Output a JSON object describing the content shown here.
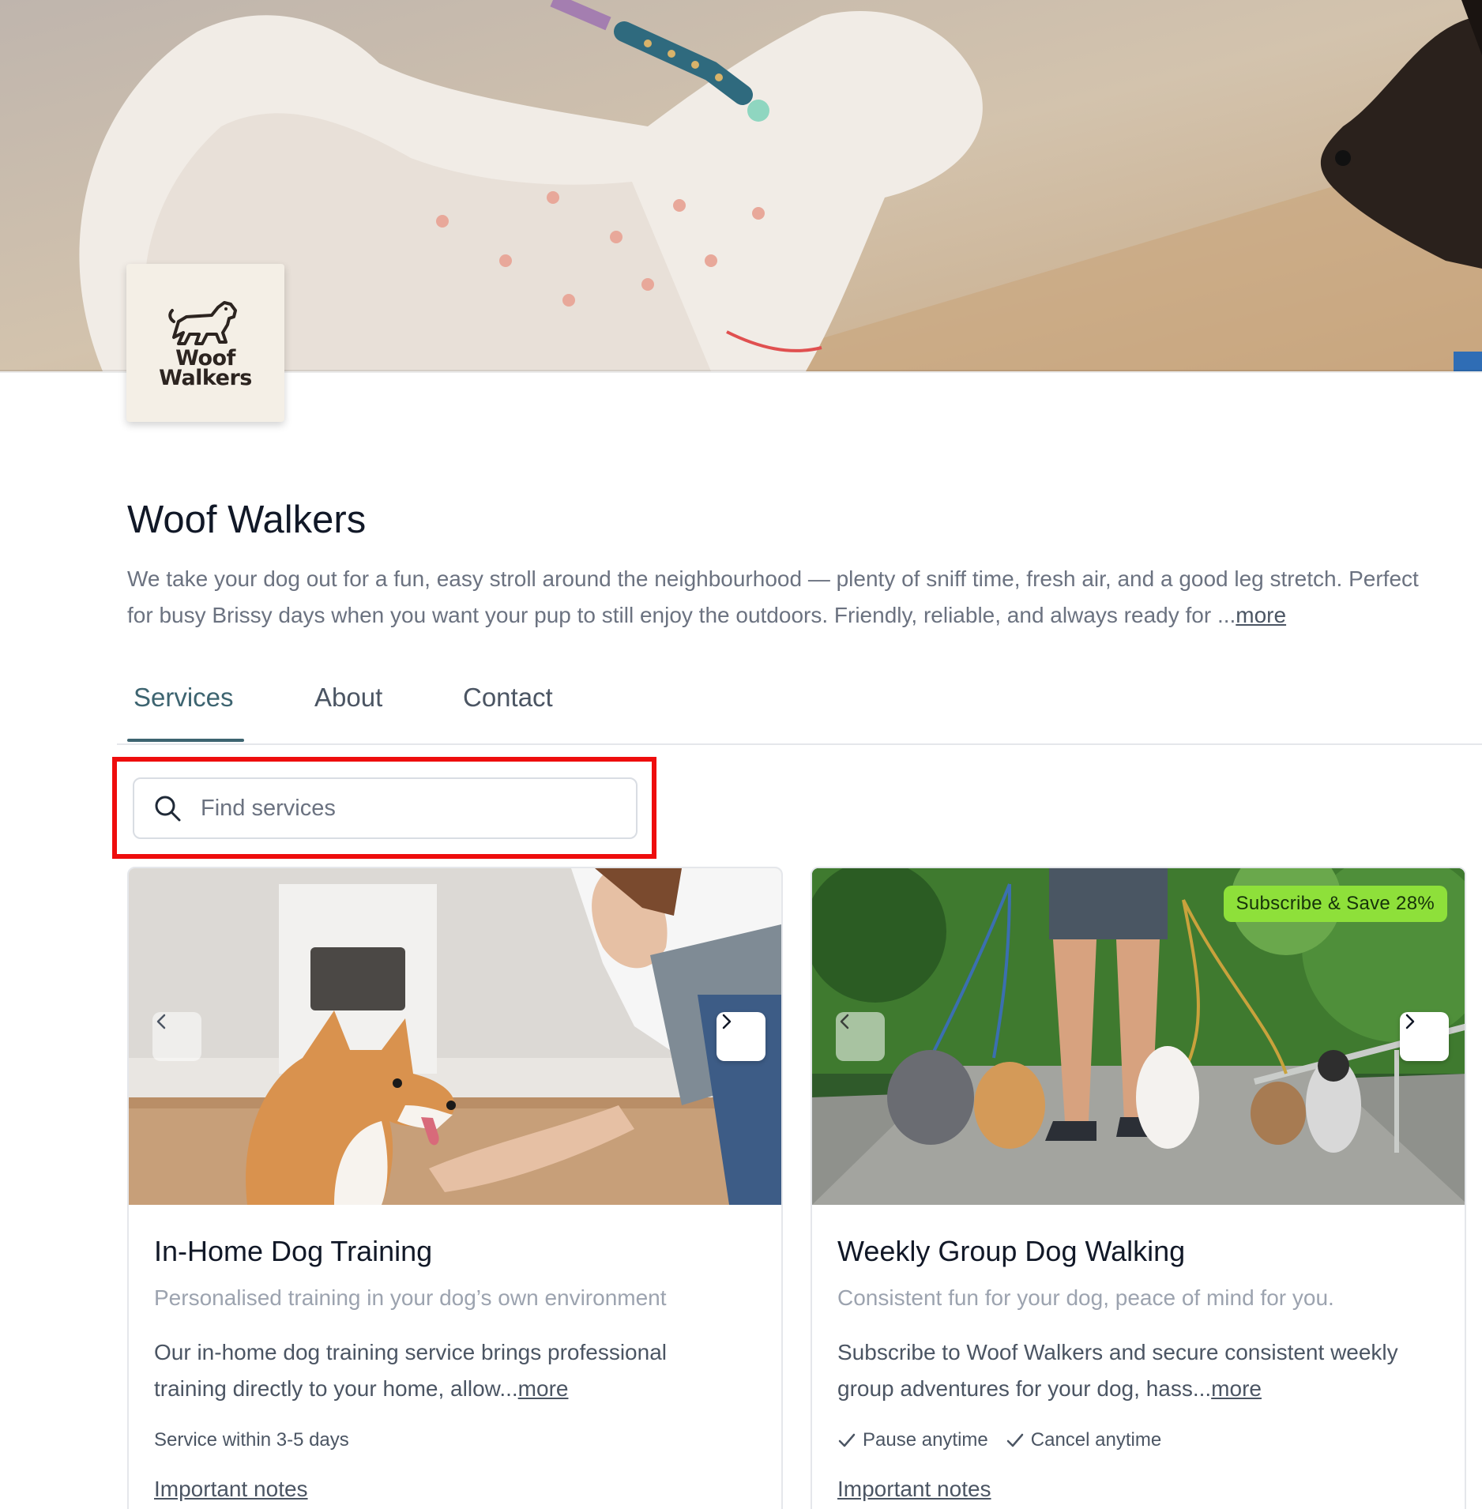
{
  "business": {
    "logo_line1": "Woof",
    "logo_line2": "Walkers",
    "name": "Woof Walkers",
    "description_line1": "We take your dog out for a fun, easy stroll around the neighbourhood — plenty of sniff time, fresh air, and a good leg stretch. Perfect",
    "description_line2": "for busy Brissy days when you want your pup to still enjoy the outdoors. Friendly, reliable, and always ready for ...",
    "more_label": "more"
  },
  "tabs": [
    {
      "label": "Services",
      "active": true
    },
    {
      "label": "About",
      "active": false
    },
    {
      "label": "Contact",
      "active": false
    }
  ],
  "search": {
    "placeholder": "Find services",
    "value": ""
  },
  "services": [
    {
      "title": "In-Home Dog Training",
      "subtitle": "Personalised training in your dog’s own environment",
      "body_line1": "Our in-home dog training service brings professional",
      "body_line2": "training directly to your home, allow...",
      "more_label": "more",
      "meta": "Service within 3-5 days",
      "notes_label": "Important notes"
    },
    {
      "title": "Weekly Group Dog Walking",
      "subtitle": "Consistent fun for your dog, peace of mind for you.",
      "body_line1": "Subscribe to Woof Walkers and secure consistent weekly",
      "body_line2": "group adventures for your dog, hass...",
      "more_label": "more",
      "badge": "Subscribe & Save 28%",
      "features": [
        "Pause anytime",
        "Cancel anytime"
      ],
      "notes_label": "Important notes"
    }
  ],
  "icons": {
    "search": "search-icon",
    "prev": "chevron-left-icon",
    "next": "chevron-right-icon",
    "check": "check-icon"
  },
  "colors": {
    "accent": "#3d6470",
    "badge": "#8ee03a",
    "highlight": "#ee0d0d"
  }
}
